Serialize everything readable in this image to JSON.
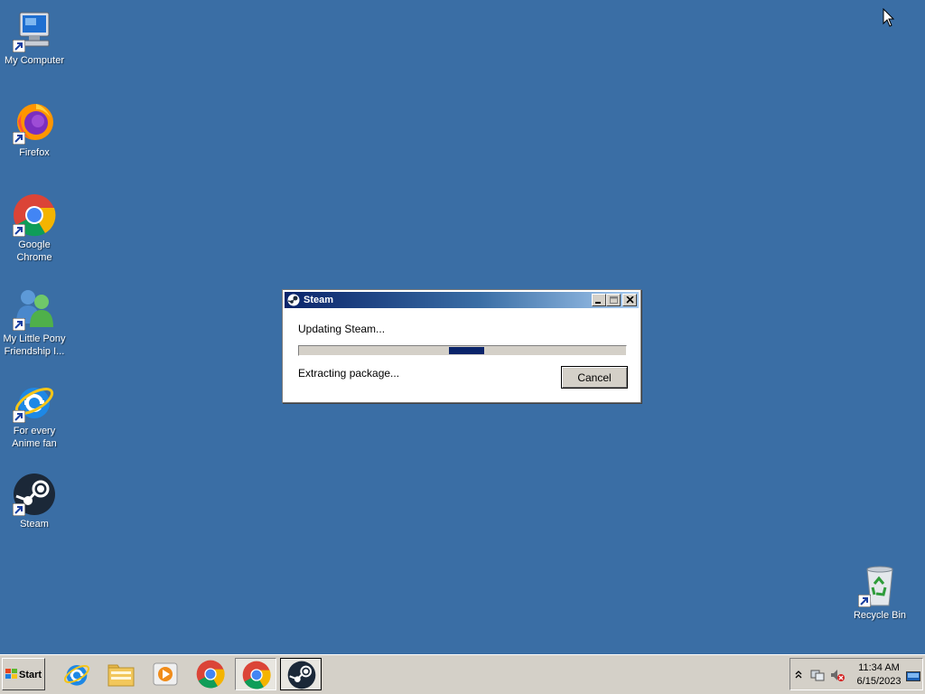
{
  "desktop": {
    "icons": [
      {
        "label": "My Computer",
        "icon": "computer-icon"
      },
      {
        "label": "Firefox",
        "icon": "firefox-icon"
      },
      {
        "label": "Google Chrome",
        "icon": "chrome-icon"
      },
      {
        "label": "My Little Pony Friendship I...",
        "icon": "users-icon"
      },
      {
        "label": "For every Anime fan",
        "icon": "internet-explorer-icon"
      },
      {
        "label": "Steam",
        "icon": "steam-icon"
      },
      {
        "label": "Recycle Bin",
        "icon": "recycle-bin-icon"
      }
    ]
  },
  "dialog": {
    "title": "Steam",
    "status": "Updating Steam...",
    "detail": "Extracting package...",
    "cancel_label": "Cancel",
    "progress_mode": "indeterminate"
  },
  "taskbar": {
    "start_label": "Start",
    "apps": [
      "internet-explorer-icon",
      "file-explorer-icon",
      "media-player-icon",
      "chrome-icon",
      "chrome-icon",
      "steam-icon"
    ],
    "active_app": "steam-icon",
    "clock": {
      "time": "11:34 AM",
      "date": "6/15/2023"
    }
  },
  "colors": {
    "desktop": "#3a6ea5",
    "titlebar_start": "#0a246a",
    "progress_chunk": "#0a246a",
    "taskbar": "#d4d0c8"
  }
}
